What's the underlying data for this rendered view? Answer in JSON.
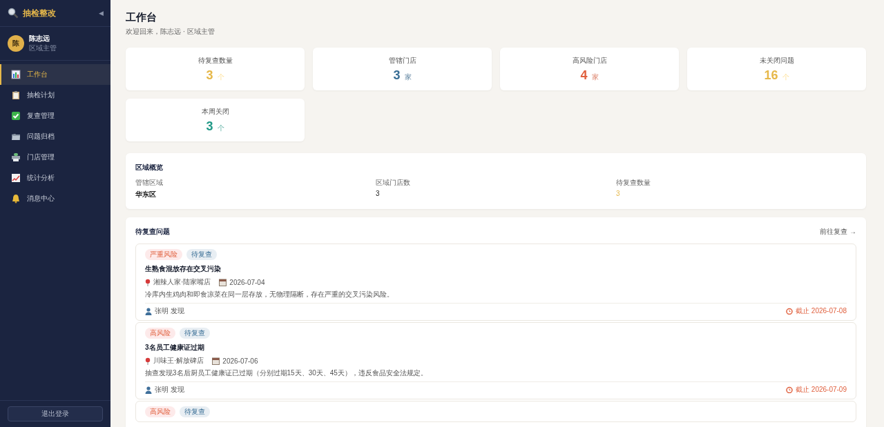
{
  "sidebar": {
    "app_title": "抽检整改",
    "collapse_glyph": "◀",
    "user": {
      "avatar": "陈",
      "name": "陈志远",
      "role": "区域主管"
    },
    "items": [
      {
        "label": "工作台",
        "selected": true
      },
      {
        "label": "抽检计划",
        "selected": false
      },
      {
        "label": "复查管理",
        "selected": false
      },
      {
        "label": "问题归档",
        "selected": false
      },
      {
        "label": "门店管理",
        "selected": false
      },
      {
        "label": "统计分析",
        "selected": false
      },
      {
        "label": "消息中心",
        "selected": false
      }
    ],
    "logout": "退出登录"
  },
  "header": {
    "title": "工作台",
    "subtitle": "欢迎回来，陈志远 · 区域主管"
  },
  "stats": [
    {
      "label": "待复查数量",
      "value": "3",
      "unit": "个",
      "color": "#e6b84a"
    },
    {
      "label": "管辖门店",
      "value": "3",
      "unit": "家",
      "color": "#3a6f96"
    },
    {
      "label": "高风险门店",
      "value": "4",
      "unit": "家",
      "color": "#e0603e"
    },
    {
      "label": "未关闭问题",
      "value": "16",
      "unit": "个",
      "color": "#e6b84a"
    },
    {
      "label": "本周关闭",
      "value": "3",
      "unit": "个",
      "color": "#229a88"
    }
  ],
  "overview": {
    "title": "区域概览",
    "fields": [
      {
        "label": "管辖区域",
        "value": "华东区",
        "kind": "bold"
      },
      {
        "label": "区域门店数",
        "value": "3",
        "kind": "plain"
      },
      {
        "label": "待复查数量",
        "value": "3",
        "kind": "warn"
      }
    ]
  },
  "issues": {
    "title": "待复查问题",
    "link": "前往复查 →",
    "items": [
      {
        "risk": "严重风险",
        "status": "待复查",
        "title": "生熟食混放存在交叉污染",
        "store": "湘辣人家·陆家嘴店",
        "date": "2026-07-04",
        "desc": "冷库内生鸡肉和即食凉菜在同一层存放，无物理隔断，存在严重的交叉污染风险。",
        "finder": "张明 发现",
        "deadline": "截止 2026-07-08"
      },
      {
        "risk": "高风险",
        "status": "待复查",
        "title": "3名员工健康证过期",
        "store": "川味王·解放碑店",
        "date": "2026-07-06",
        "desc": "抽查发现3名后厨员工健康证已过期（分别过期15天、30天、45天），违反食品安全法规定。",
        "finder": "张明 发现",
        "deadline": "截止 2026-07-09"
      },
      {
        "risk": "高风险",
        "status": "待复查"
      }
    ]
  }
}
